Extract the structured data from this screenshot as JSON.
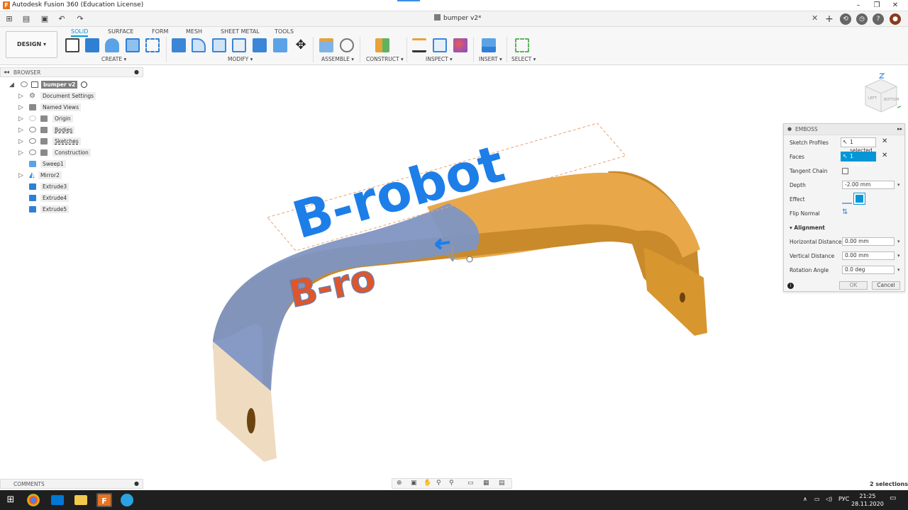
{
  "window": {
    "title": "Autodesk Fusion 360 (Education License)",
    "doc_tab": "bumper v2*",
    "controls": [
      "–",
      "❐",
      "✕"
    ]
  },
  "ribbon": {
    "workspace": "DESIGN ▾",
    "tabs": [
      "SOLID",
      "SURFACE",
      "FORM",
      "MESH",
      "SHEET METAL",
      "TOOLS"
    ],
    "groups": [
      "CREATE ▾",
      "MODIFY ▾",
      "ASSEMBLE ▾",
      "CONSTRUCT ▾",
      "INSPECT ▾",
      "INSERT ▾",
      "SELECT ▾"
    ]
  },
  "browser": {
    "title": "BROWSER",
    "root": "bumper v2",
    "items": [
      {
        "label": "Document Settings",
        "icon": "gear-icon"
      },
      {
        "label": "Named Views",
        "icon": "folder-icon"
      },
      {
        "label": "Origin",
        "icon": "folder-icon"
      },
      {
        "label": "Bodies",
        "icon": "folder-icon"
      },
      {
        "label": "Sketches",
        "icon": "folder-icon"
      },
      {
        "label": "Construction",
        "icon": "folder-icon"
      },
      {
        "label": "Sweep1",
        "icon": "body-icon"
      },
      {
        "label": "Mirror2",
        "icon": "mirror-icon"
      },
      {
        "label": "Extrude3",
        "icon": "body-icon"
      },
      {
        "label": "Extrude4",
        "icon": "body-icon"
      },
      {
        "label": "Extrude5",
        "icon": "body-icon"
      }
    ]
  },
  "viewport": {
    "emboss_text": "B-robot",
    "cut_text": "B-ro"
  },
  "emboss_panel": {
    "title": "EMBOSS",
    "sketch_profiles_label": "Sketch Profiles",
    "sketch_profiles_value": "1 selected",
    "faces_label": "Faces",
    "faces_value": "1 selected",
    "tangent_chain_label": "Tangent Chain",
    "depth_label": "Depth",
    "depth_value": "-2.00 mm",
    "effect_label": "Effect",
    "flip_normal_label": "Flip Normal",
    "alignment_label": "Alignment",
    "horizontal_distance_label": "Horizontal Distance",
    "horizontal_distance_value": "0.00 mm",
    "vertical_distance_label": "Vertical Distance",
    "vertical_distance_value": "0.00 mm",
    "rotation_angle_label": "Rotation Angle",
    "rotation_angle_value": "0.0 deg",
    "ok_label": "OK",
    "cancel_label": "Cancel"
  },
  "comments": {
    "label": "COMMENTS"
  },
  "status": {
    "selections": "2 selections"
  },
  "taskbar": {
    "lang": "РУС",
    "time": "21:25",
    "date": "28.11.2020"
  },
  "colors": {
    "accent": "#0696d7",
    "bumper_orange": "#e8a84a",
    "selected_blue": "#7f95c2",
    "emboss_red": "#e0552b",
    "text_blue": "#1d7ee8"
  }
}
